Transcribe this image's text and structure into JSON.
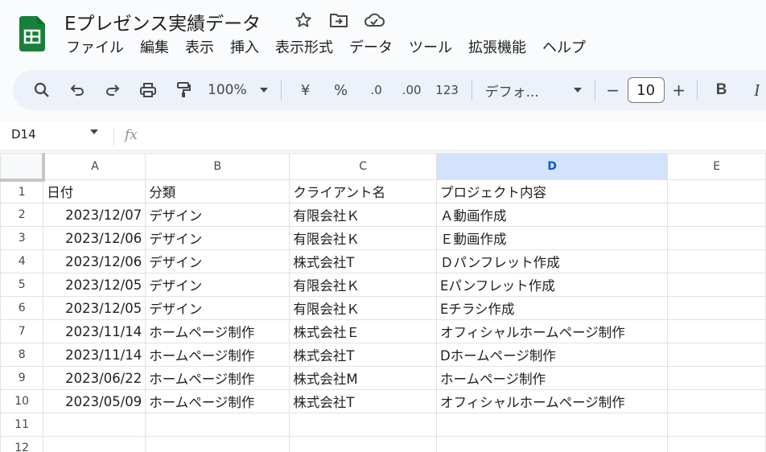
{
  "app": {
    "title": "Eプレゼンス実績データ",
    "brand_color": "#188038"
  },
  "menu": [
    "ファイル",
    "編集",
    "表示",
    "挿入",
    "表示形式",
    "データ",
    "ツール",
    "拡張機能",
    "ヘルプ"
  ],
  "toolbar": {
    "zoom": "100%",
    "currency": "¥",
    "percent": "%",
    "dec_decrease": ".0",
    "dec_increase": ".00",
    "number_format": "123",
    "font": "デフォ...",
    "font_size": "10",
    "minus": "−",
    "plus": "+",
    "bold": "B",
    "italic": "I"
  },
  "formula_bar": {
    "cell_ref": "D14",
    "fx": "fx"
  },
  "sheet": {
    "columns": [
      "A",
      "B",
      "C",
      "D",
      "E"
    ],
    "active_column": "D",
    "rows": [
      {
        "n": "1",
        "a": "日付",
        "b": "分類",
        "c": "クライアント名",
        "d": "プロジェクト内容"
      },
      {
        "n": "2",
        "a": "2023/12/07",
        "b": "デザイン",
        "c": "有限会社Ｋ",
        "d": "Ａ動画作成"
      },
      {
        "n": "3",
        "a": "2023/12/06",
        "b": "デザイン",
        "c": "有限会社Ｋ",
        "d": "Ｅ動画作成"
      },
      {
        "n": "4",
        "a": "2023/12/06",
        "b": "デザイン",
        "c": "株式会社T",
        "d": "Ｄパンフレット作成"
      },
      {
        "n": "5",
        "a": "2023/12/05",
        "b": "デザイン",
        "c": "有限会社Ｋ",
        "d": "Eパンフレット作成"
      },
      {
        "n": "6",
        "a": "2023/12/05",
        "b": "デザイン",
        "c": "有限会社Ｋ",
        "d": "Eチラシ作成"
      },
      {
        "n": "7",
        "a": "2023/11/14",
        "b": "ホームページ制作",
        "c": "株式会社Ｅ",
        "d": "オフィシャルホームページ制作"
      },
      {
        "n": "8",
        "a": "2023/11/14",
        "b": "ホームページ制作",
        "c": "株式会社T",
        "d": "Dホームページ制作"
      },
      {
        "n": "9",
        "a": "2023/06/22",
        "b": "ホームページ制作",
        "c": "株式会社M",
        "d": "ホームページ制作"
      },
      {
        "n": "10",
        "a": "2023/05/09",
        "b": "ホームページ制作",
        "c": "株式会社T",
        "d": "オフィシャルホームページ制作"
      },
      {
        "n": "11",
        "a": "",
        "b": "",
        "c": "",
        "d": ""
      },
      {
        "n": "12",
        "a": "",
        "b": "",
        "c": "",
        "d": ""
      }
    ]
  }
}
